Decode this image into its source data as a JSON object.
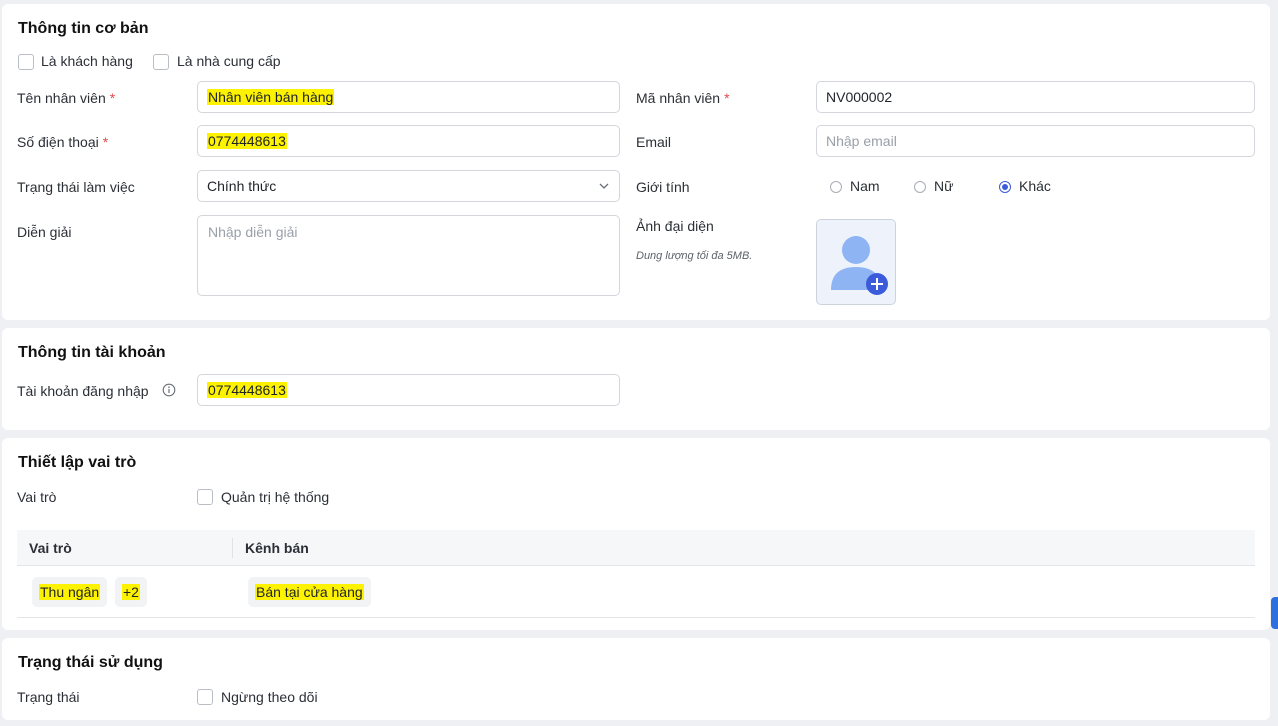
{
  "basic_info": {
    "title": "Thông tin cơ bản",
    "is_customer_label": "Là khách hàng",
    "is_supplier_label": "Là nhà cung cấp",
    "employee_name_label": "Tên nhân viên",
    "employee_name_value": "Nhân viên bán hàng",
    "employee_code_label": "Mã nhân viên",
    "employee_code_value": "NV000002",
    "phone_label": "Số điện thoại",
    "phone_value": "0774448613",
    "email_label": "Email",
    "email_placeholder": "Nhập email",
    "work_status_label": "Trạng thái làm việc",
    "work_status_value": "Chính thức",
    "gender_label": "Giới tính",
    "gender_options": [
      "Nam",
      "Nữ",
      "Khác"
    ],
    "gender_selected": "Khác",
    "description_label": "Diễn giải",
    "description_placeholder": "Nhập diễn giải",
    "avatar_label": "Ảnh đại diện",
    "avatar_note": "Dung lượng tối đa 5MB.",
    "required_mark": "*"
  },
  "account_info": {
    "title": "Thông tin tài khoản",
    "login_label": "Tài khoản đăng nhập",
    "login_value": "0774448613"
  },
  "role_setup": {
    "title": "Thiết lập vai trò",
    "role_label": "Vai trò",
    "admin_label": "Quản trị hệ thống",
    "table_headers": [
      "Vai trò",
      "Kênh bán"
    ],
    "rows": [
      {
        "role": "Thu ngân",
        "extra": "+2",
        "channel": "Bán tại cửa hàng"
      }
    ]
  },
  "usage_status": {
    "title": "Trạng thái sử dụng",
    "status_label": "Trạng thái",
    "stop_tracking_label": "Ngừng theo dõi"
  },
  "colors": {
    "highlight": "#fdf200",
    "accent": "#3b5bdb",
    "required": "#e5484d"
  }
}
